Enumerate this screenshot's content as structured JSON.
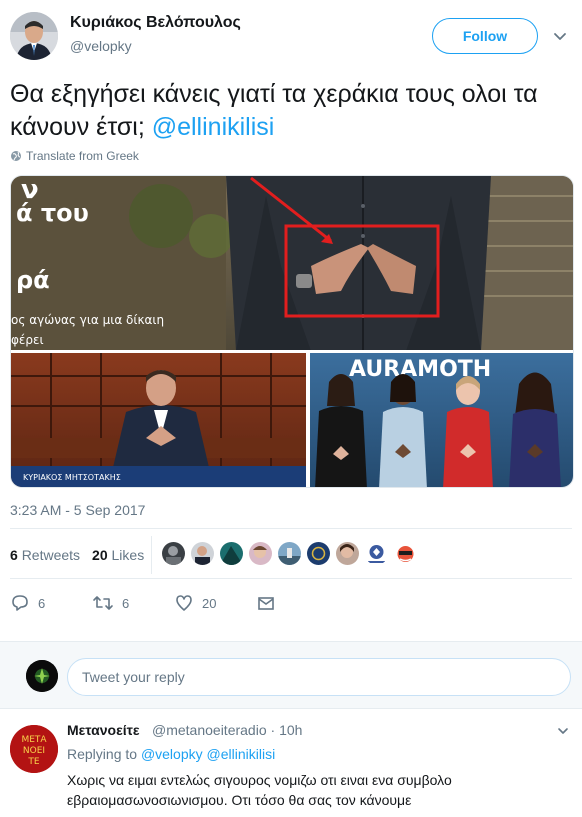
{
  "author": {
    "name": "Κυριάκος Βελόπουλος",
    "handle": "@velopky",
    "follow_label": "Follow"
  },
  "tweet": {
    "text": "Θα εξηγήσει κάνεις γιατί τα χεράκια τους ολοι τα κάνουν έτσι;",
    "mention": "@ellinikilisi",
    "translate_label": "Translate from Greek",
    "timestamp": "3:23 AM - 5 Sep 2017"
  },
  "media": {
    "top_text_1": "ν",
    "top_text_2": "ά του",
    "top_text_3": "ρά",
    "top_caption_1": "ος αγώνας για μια δίκαιη",
    "top_caption_2": "φέρει",
    "right_banner": "AURAMOTH",
    "lower_caption": "ΚΥΡΙΑΚΟΣ ΜΗΤΣΟΤΑΚΗΣ"
  },
  "stats": {
    "retweets_count": "6",
    "retweets_label": "Retweets",
    "likes_count": "20",
    "likes_label": "Likes"
  },
  "actions": {
    "reply_count": "6",
    "retweet_count": "6",
    "like_count": "20"
  },
  "reply_box": {
    "placeholder": "Tweet your reply"
  },
  "reply": {
    "name": "Μετανοείτε",
    "handle": "@metanoeiteradio",
    "time": "10h",
    "separator": "·",
    "replying_to_label": "Replying to",
    "replying_to_1": "@velopky",
    "replying_to_2": "@ellinikilisi",
    "text": "Χωρις να ειμαι εντελώς σιγουρος νομιζω οτι ειναι ενα συμβολο εβραιομασωνοσιωνισμου. Οτι τόσο θα σας τον κάνουμε",
    "avatar_text_1": "ΜΕΤΑ",
    "avatar_text_2": "ΝΟΕΙ",
    "avatar_text_3": "ΤΕ"
  },
  "colors": {
    "accent": "#1da1f2",
    "muted": "#657786",
    "text": "#14171a"
  }
}
